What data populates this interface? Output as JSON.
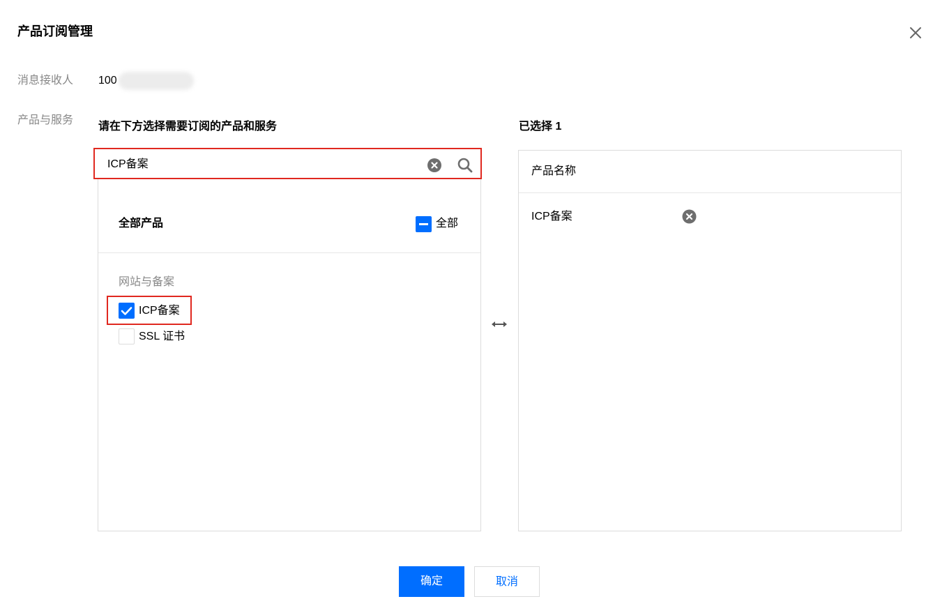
{
  "dialog": {
    "title": "产品订阅管理",
    "close_icon": "close-icon"
  },
  "receiver": {
    "label": "消息接收人",
    "value": "100"
  },
  "products_label": "产品与服务",
  "left_panel": {
    "heading": "请在下方选择需要订阅的产品和服务",
    "search": {
      "value": "ICP备案",
      "clear_icon": "clear-circle-icon",
      "search_icon": "search-icon"
    },
    "all_products_title": "全部产品",
    "select_all_label": "全部",
    "select_all_state": "indeterminate",
    "groups": [
      {
        "label": "网站与备案",
        "items": [
          {
            "label": "ICP备案",
            "checked": true
          },
          {
            "label": "SSL 证书",
            "checked": false
          }
        ]
      }
    ]
  },
  "right_panel": {
    "heading": "已选择 1",
    "column_header": "产品名称",
    "selected": [
      {
        "label": "ICP备案",
        "remove_icon": "remove-circle-icon"
      }
    ]
  },
  "transfer_icon": "left-right-arrow-icon",
  "footer": {
    "confirm_label": "确定",
    "cancel_label": "取消"
  },
  "colors": {
    "primary": "#006eff",
    "highlight_border": "#e0281f",
    "muted_text": "#888888",
    "border": "#dcdcdc"
  }
}
